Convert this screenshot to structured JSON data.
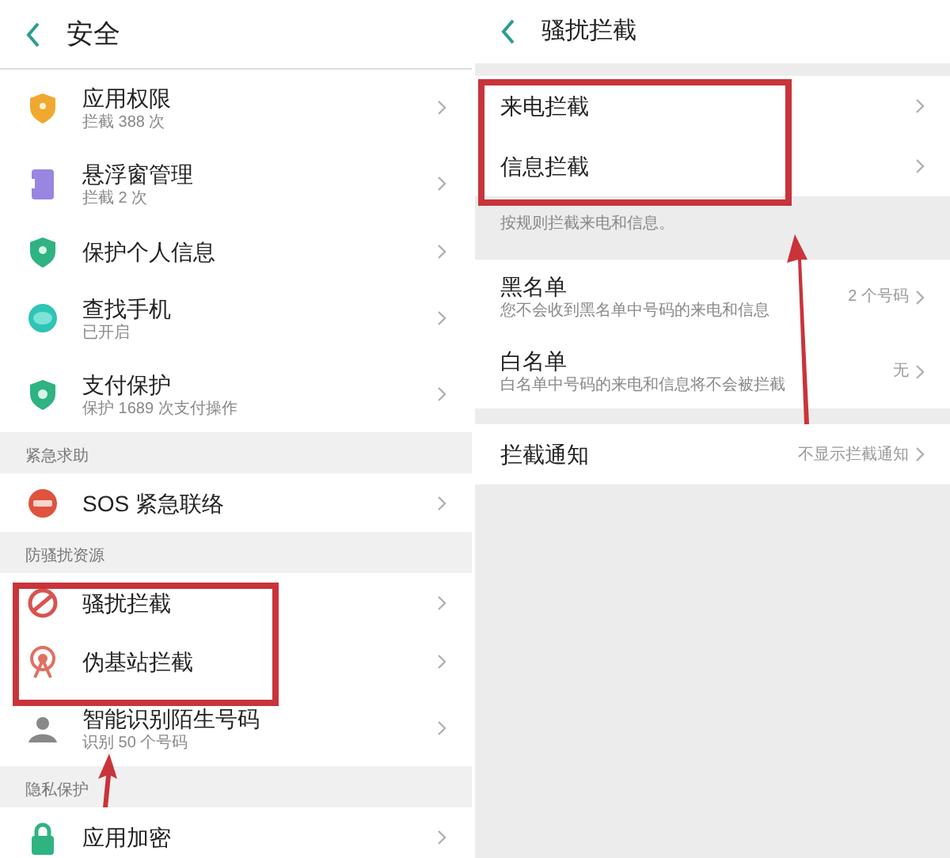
{
  "left_screen": {
    "title": "安全",
    "sections": [
      {
        "items": [
          {
            "title": "应用权限",
            "subtitle": "拦截 388 次"
          },
          {
            "title": "悬浮窗管理",
            "subtitle": "拦截 2 次"
          },
          {
            "title": "保护个人信息"
          },
          {
            "title": "查找手机",
            "subtitle": "已开启"
          },
          {
            "title": "支付保护",
            "subtitle": "保护 1689 次支付操作"
          }
        ]
      },
      {
        "header": "紧急求助",
        "items": [
          {
            "title": "SOS 紧急联络"
          }
        ]
      },
      {
        "header": "防骚扰资源",
        "items": [
          {
            "title": "骚扰拦截"
          },
          {
            "title": "伪基站拦截"
          },
          {
            "title": "智能识别陌生号码",
            "subtitle": "识别 50 个号码"
          }
        ]
      },
      {
        "header": "隐私保护",
        "items": [
          {
            "title": "应用加密"
          }
        ]
      }
    ]
  },
  "right_screen": {
    "title": "骚扰拦截",
    "groups": [
      {
        "items": [
          {
            "title": "来电拦截"
          },
          {
            "title": "信息拦截"
          }
        ],
        "footer": "按规则拦截来电和信息。"
      },
      {
        "items": [
          {
            "title": "黑名单",
            "subtitle": "您不会收到黑名单中号码的来电和信息",
            "value": "2 个号码"
          },
          {
            "title": "白名单",
            "subtitle": "白名单中号码的来电和信息将不会被拦截",
            "value": "无"
          }
        ]
      },
      {
        "items": [
          {
            "title": "拦截通知",
            "value": "不显示拦截通知"
          }
        ]
      }
    ]
  }
}
